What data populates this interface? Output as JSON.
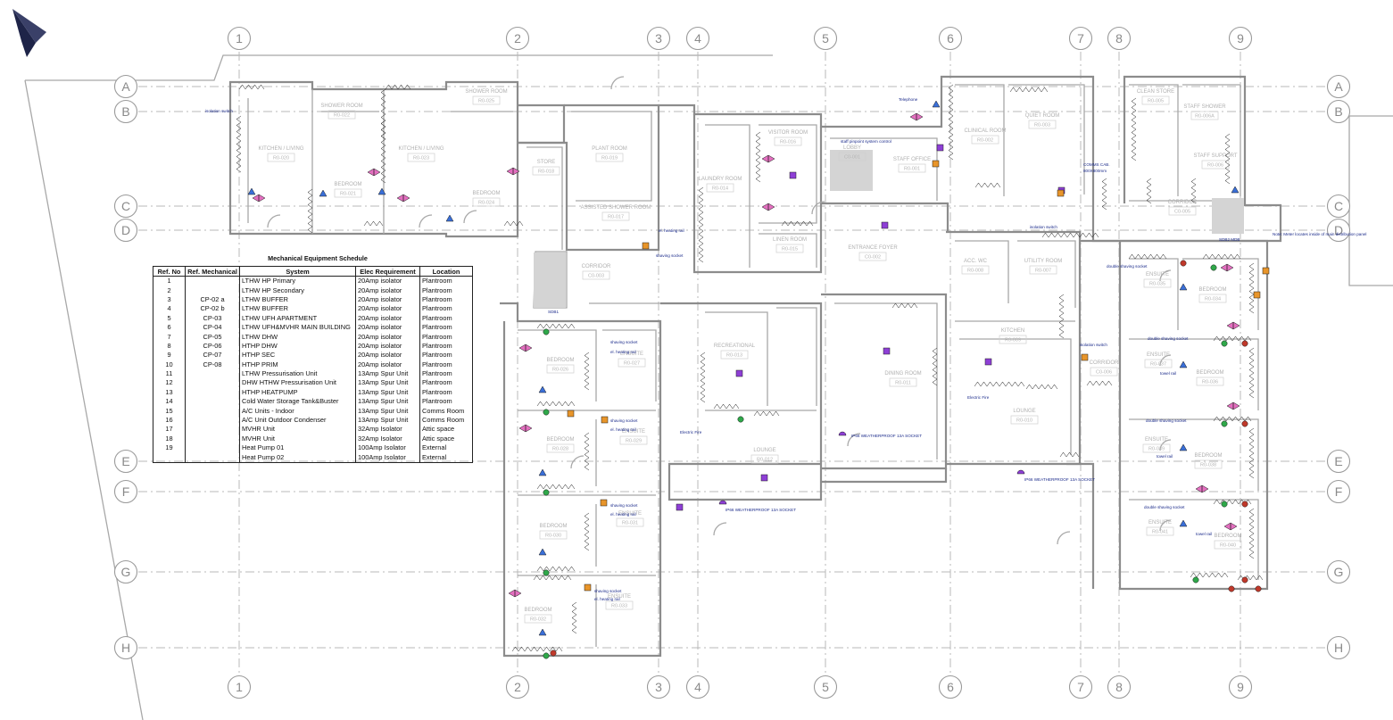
{
  "grid": {
    "columns": [
      {
        "label": "1"
      },
      {
        "label": "2"
      },
      {
        "label": "3"
      },
      {
        "label": "4"
      },
      {
        "label": "5"
      },
      {
        "label": "6"
      },
      {
        "label": "7"
      },
      {
        "label": "8"
      },
      {
        "label": "9"
      }
    ],
    "rows": [
      {
        "label": "A"
      },
      {
        "label": "B"
      },
      {
        "label": "C"
      },
      {
        "label": "D"
      },
      {
        "label": "E"
      },
      {
        "label": "F"
      },
      {
        "label": "G"
      },
      {
        "label": "H"
      }
    ]
  },
  "rooms": [
    {
      "name": "KITCHEN / LIVING",
      "number": "R0-020"
    },
    {
      "name": "SHOWER ROOM",
      "number": "R0-022"
    },
    {
      "name": "BEDROOM",
      "number": "R0-021"
    },
    {
      "name": "KITCHEN / LIVING",
      "number": "R0-023"
    },
    {
      "name": "SHOWER ROOM",
      "number": "R0-025"
    },
    {
      "name": "BEDROOM",
      "number": "R0-024"
    },
    {
      "name": "STORE",
      "number": "R0-018"
    },
    {
      "name": "PLANT ROOM",
      "number": "R0-019"
    },
    {
      "name": "ASSISTED SHOWER ROOM",
      "number": "R0-017"
    },
    {
      "name": "CORRIDOR",
      "number": "C0-003"
    },
    {
      "name": "LAUNDRY ROOM",
      "number": "R0-014"
    },
    {
      "name": "VISITOR ROOM",
      "number": "R0-016"
    },
    {
      "name": "LINEN ROOM",
      "number": "R0-015"
    },
    {
      "name": "LOBBY",
      "number": "C0-001"
    },
    {
      "name": "STAFF OFFICE",
      "number": "R0-001"
    },
    {
      "name": "ENTRANCE FOYER",
      "number": "C0-002"
    },
    {
      "name": "CLINICAL ROOM",
      "number": "R0-002"
    },
    {
      "name": "QUIET ROOM",
      "number": "R0-003"
    },
    {
      "name": "CLEAN STORE",
      "number": "R0-005"
    },
    {
      "name": "STAFF SHOWER",
      "number": "R0-006A"
    },
    {
      "name": "STAFF SUPPORT",
      "number": "R0-006"
    },
    {
      "name": "CORRIDOR",
      "number": "C0-005"
    },
    {
      "name": "ACC. WC",
      "number": "R0-008"
    },
    {
      "name": "UTILITY ROOM",
      "number": "R0-007"
    },
    {
      "name": "KITCHEN",
      "number": "R0-009"
    },
    {
      "name": "LOUNGE",
      "number": "R0-010"
    },
    {
      "name": "CORRIDOR",
      "number": "C0-006"
    },
    {
      "name": "DINING ROOM",
      "number": "R0-011"
    },
    {
      "name": "RECREATIONAL",
      "number": "R0-013"
    },
    {
      "name": "LOUNGE",
      "number": "R0-012"
    },
    {
      "name": "BEDROOM",
      "number": "R0-026"
    },
    {
      "name": "ENSUITE",
      "number": "R0-027"
    },
    {
      "name": "BEDROOM",
      "number": "R0-028"
    },
    {
      "name": "ENSUITE",
      "number": "R0-029"
    },
    {
      "name": "BEDROOM",
      "number": "R0-030"
    },
    {
      "name": "ENSUITE",
      "number": "R0-031"
    },
    {
      "name": "BEDROOM",
      "number": "R0-032"
    },
    {
      "name": "ENSUITE",
      "number": "R0-033"
    },
    {
      "name": "ENSUITE",
      "number": "R0-035"
    },
    {
      "name": "BEDROOM",
      "number": "R0-034"
    },
    {
      "name": "ENSUITE",
      "number": "R0-037"
    },
    {
      "name": "BEDROOM",
      "number": "R0-036"
    },
    {
      "name": "ENSUITE",
      "number": "R0-039"
    },
    {
      "name": "BEDROOM",
      "number": "R0-038"
    },
    {
      "name": "ENSUITE",
      "number": "R0-041"
    },
    {
      "name": "BEDROOM",
      "number": "R0-040"
    }
  ],
  "annotations": {
    "comms_cab": "COMMS CAB.",
    "comms_cab_size": "800X800mm",
    "telephone": "Telephone",
    "staff_control": "staff pinpoint system control",
    "socket1": "IP66 WEATHERPROOF 13A SOCKET",
    "socket2": "IP66 WEATHERPROOF 13A SOCKET",
    "socket3": "IP66 WEATHERPROOF 13A SOCKET",
    "db1": "SDB1",
    "db2": "SDB2 MDB",
    "electric_fire": "Electric Fire",
    "isolator_switch": "isolation switch",
    "shaving_socket": "shaving socket",
    "heating_rail": "el. heating rail",
    "towel_rail": "towel rail",
    "double_shaving": "double shaving socket",
    "meter_note": "Note: Meter locates inside of main distribution panel"
  },
  "schedule": {
    "title": "Mechanical Equipment Schedule",
    "headers": [
      "Ref. No",
      "Ref. Mechanical",
      "System",
      "Elec Requirement",
      "Location"
    ],
    "rows": [
      [
        "1",
        "",
        "LTHW HP Primary",
        "20Amp isolator",
        "Plantroom"
      ],
      [
        "2",
        "",
        "LTHW HP Secondary",
        "20Amp isolator",
        "Plantroom"
      ],
      [
        "3",
        "CP-02 a",
        "LTHW BUFFER",
        "20Amp isolator",
        "Plantroom"
      ],
      [
        "4",
        "CP-02 b",
        "LTHW BUFFER",
        "20Amp isolator",
        "Plantroom"
      ],
      [
        "5",
        "CP-03",
        "LTHW UFH APARTMENT",
        "20Amp isolator",
        "Plantroom"
      ],
      [
        "6",
        "CP-04",
        "LTHW UFH&MVHR MAIN BUILDING",
        "20Amp isolator",
        "Plantroom"
      ],
      [
        "7",
        "CP-05",
        "LTHW DHW",
        "20Amp isolator",
        "Plantroom"
      ],
      [
        "8",
        "CP-06",
        "HTHP DHW",
        "20Amp isolator",
        "Plantroom"
      ],
      [
        "9",
        "CP-07",
        "HTHP SEC",
        "20Amp isolator",
        "Plantroom"
      ],
      [
        "10",
        "CP-08",
        "HTHP PRIM",
        "20Amp isolator",
        "Plantroom"
      ],
      [
        "11",
        "",
        "LTHW Pressurisation Unit",
        "13Amp Spur Unit",
        "Plantroom"
      ],
      [
        "12",
        "",
        "DHW HTHW Pressurisation Unit",
        "13Amp Spur Unit",
        "Plantroom"
      ],
      [
        "13",
        "",
        "HTHP HEATPUMP",
        "13Amp Spur Unit",
        "Plantroom"
      ],
      [
        "14",
        "",
        "Cold Water Storage Tank&Buster",
        "13Amp Spur Unit",
        "Plantroom"
      ],
      [
        "15",
        "",
        "A/C Units - Indoor",
        "13Amp Spur Unit",
        "Comms Room"
      ],
      [
        "16",
        "",
        "A/C Unit Outdoor Condenser",
        "13Amp Spur Unit",
        "Comms Room"
      ],
      [
        "17",
        "",
        "MVHR Unit",
        "32Amp Isolator",
        "Attic space"
      ],
      [
        "18",
        "",
        "MVHR Unit",
        "32Amp Isolator",
        "Attic space"
      ],
      [
        "19",
        "",
        "Heat Pump 01",
        "100Amp Isolator",
        "External"
      ],
      [
        "",
        "",
        "Heat Pump 02",
        "100Amp Isolator",
        "External"
      ]
    ]
  },
  "colors": {
    "annotation": "#1a2a8a",
    "wall": "#8c8c8c",
    "grid": "#b8b8b8",
    "device_blue": "#3a6fd8",
    "device_pink": "#e46fc0",
    "device_green": "#2fa84a",
    "device_red": "#c0392b",
    "device_orange": "#e8952a",
    "device_purple": "#8e3fd6"
  }
}
